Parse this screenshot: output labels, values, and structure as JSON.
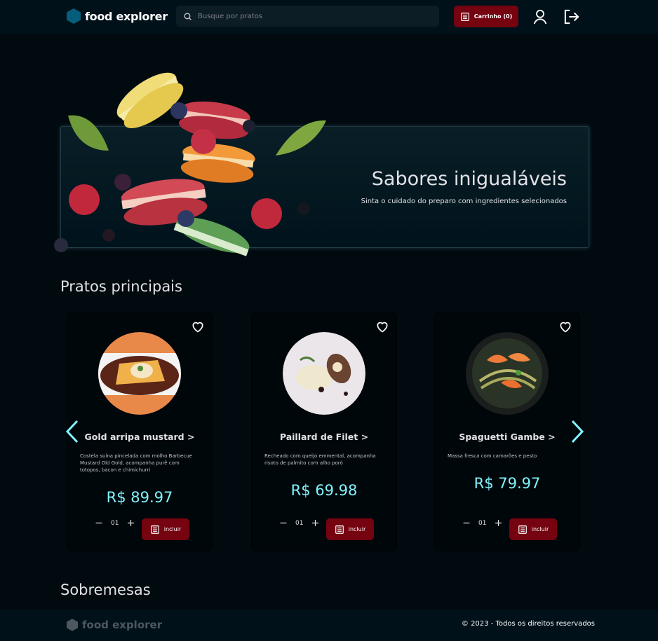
{
  "header": {
    "logo_text": "food explorer",
    "search_placeholder": "Busque por pratos",
    "cart_label": "Carrinho (0)"
  },
  "banner": {
    "title": "Sabores inigualáveis",
    "subtitle": "Sinta o cuidado do preparo com ingredientes selecionados"
  },
  "sections": {
    "main_title": "Pratos principais",
    "dessert_title": "Sobremesas"
  },
  "dishes": [
    {
      "name": "Gold arripa mustard",
      "description": "Costela suína pincelada com molho Barbecue Mustard Old Gold, acompanha purê com totopos, bacon e chimichurri",
      "price": "R$ 89.97",
      "quantity": "01",
      "button": "incluir"
    },
    {
      "name": "Paillard de Filet",
      "description": "Recheado com queijo emmental, acompanha risoto de palmito com alho poró",
      "price": "R$ 69.98",
      "quantity": "01",
      "button": "incluir"
    },
    {
      "name": "Spaguetti Gambe",
      "description": "Massa fresca com camarões e pesto",
      "price": "R$ 79.97",
      "quantity": "01",
      "button": "incluir"
    }
  ],
  "name_chevron": ">",
  "footer": {
    "logo_text": "food explorer",
    "copyright": "© 2023 - Todos os direitos reservados"
  },
  "colors": {
    "background": "#000a0f",
    "header": "#00111a",
    "accent_red": "#750310",
    "price_cyan": "#82f3ff",
    "logo_blue": "#065e7c"
  },
  "icons": [
    "hexagon-logo-icon",
    "search-icon",
    "receipt-icon",
    "user-icon",
    "sign-out-icon",
    "heart-icon",
    "chevron-left-icon",
    "chevron-right-icon",
    "minus-icon",
    "plus-icon"
  ]
}
